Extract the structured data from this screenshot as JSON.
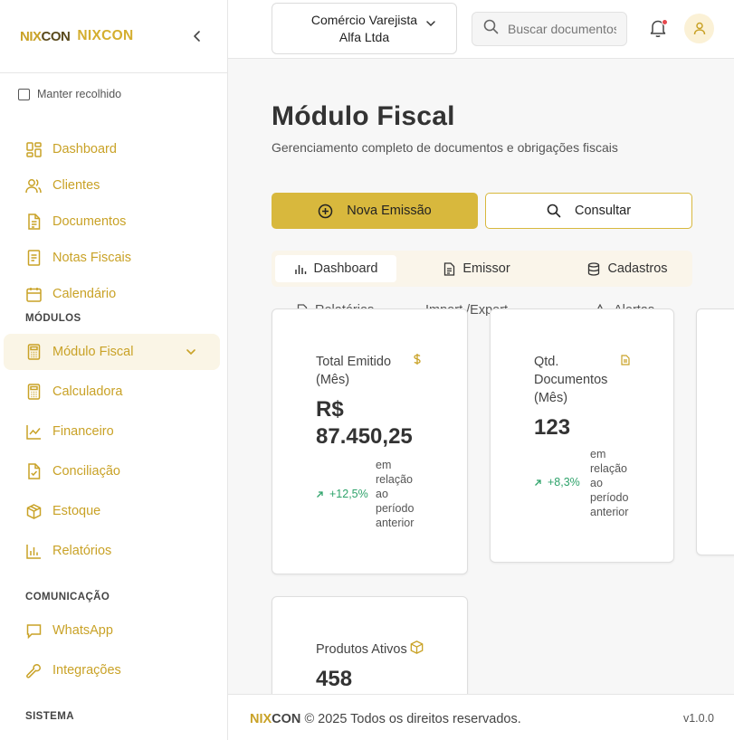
{
  "brand": {
    "logo_mark_nix": "NIX",
    "logo_mark_con": "CON",
    "name": "NIXCON"
  },
  "sidebar": {
    "keep_collapsed_label": "Manter recolhido",
    "items": [
      {
        "label": "Dashboard",
        "icon": "grid-icon"
      },
      {
        "label": "Clientes",
        "icon": "users-icon"
      },
      {
        "label": "Documentos",
        "icon": "document-icon"
      },
      {
        "label": "Notas Fiscais",
        "icon": "receipt-icon"
      },
      {
        "label": "Calendário",
        "icon": "calendar-icon"
      }
    ],
    "section_modules": "MÓDULOS",
    "modules": [
      {
        "label": "Módulo Fiscal",
        "icon": "calculator-icon",
        "active": true
      },
      {
        "label": "Calculadora",
        "icon": "calculator-icon"
      },
      {
        "label": "Financeiro",
        "icon": "chart-line-icon"
      },
      {
        "label": "Conciliação",
        "icon": "file-check-icon"
      },
      {
        "label": "Estoque",
        "icon": "package-icon"
      },
      {
        "label": "Relatórios",
        "icon": "bar-chart-icon"
      }
    ],
    "section_communication": "COMUNICAÇÃO",
    "communication": [
      {
        "label": "WhatsApp",
        "icon": "message-icon"
      },
      {
        "label": "Integrações",
        "icon": "wrench-icon"
      }
    ],
    "section_system": "SISTEMA"
  },
  "header": {
    "company_line1": "Comércio Varejista",
    "company_line2": "Alfa Ltda",
    "search_placeholder": "Buscar documentos..."
  },
  "main": {
    "title": "Módulo Fiscal",
    "subtitle": "Gerenciamento completo de documentos e obrigações fiscais",
    "btn_new": "Nova Emissão",
    "btn_search": "Consultar",
    "tabs": [
      "Dashboard",
      "Emissor",
      "Cadastros"
    ],
    "tabs_row2": [
      "Relatórios",
      "Alertas",
      "Import./Export."
    ],
    "cards": [
      {
        "title_line1": "Total Emitido",
        "title_line2": "(Mês)",
        "value_line1": "R$",
        "value_line2": "87.450,25",
        "change": "+12,5%",
        "note": [
          "em",
          "relação",
          "ao",
          "período",
          "anterior"
        ]
      },
      {
        "title_line1": "Qtd.",
        "title_line2": "Documentos",
        "title_line3": "(Mês)",
        "value": "123",
        "change": "+8,3%",
        "note": [
          "em",
          "relação",
          "ao",
          "período",
          "anterior"
        ]
      },
      {
        "title": "Produtos Ativos",
        "value": "458"
      }
    ]
  },
  "footer": {
    "nix": "NIX",
    "con": "CON",
    "copyright": "© 2025 Todos os direitos reservados.",
    "version": "v1.0.0"
  },
  "colors": {
    "accent": "#d8b83d",
    "accent_text": "#c9a227",
    "positive": "#2fa36b",
    "notification": "#e5484d"
  }
}
